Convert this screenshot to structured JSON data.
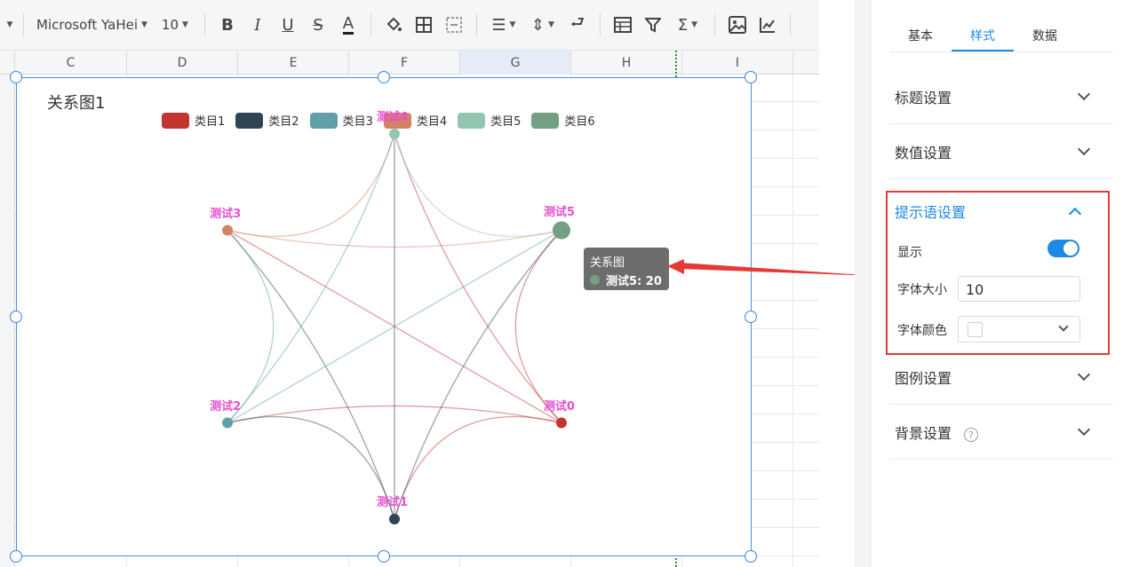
{
  "toolbar": {
    "font_name": "Microsoft YaHei",
    "font_size": "10",
    "icons": [
      "dropdown-caret",
      "bold",
      "italic",
      "underline",
      "strikethrough",
      "font-color",
      "fill-color",
      "borders",
      "merge-cells",
      "align",
      "vertical-align",
      "wrap-text",
      "table",
      "filter",
      "sum",
      "image",
      "chart"
    ]
  },
  "columns": [
    "C",
    "D",
    "E",
    "F",
    "G",
    "H",
    "I"
  ],
  "chart": {
    "title": "关系图1",
    "legend": [
      {
        "label": "类目1",
        "color": "#c23531"
      },
      {
        "label": "类目2",
        "color": "#2f4554"
      },
      {
        "label": "类目3",
        "color": "#61a0a8"
      },
      {
        "label": "类目4",
        "color": "#d48265"
      },
      {
        "label": "类目5",
        "color": "#91c7ae"
      },
      {
        "label": "类目6",
        "color": "#749f83"
      }
    ],
    "nodes": [
      {
        "name": "测试0",
        "color": "#c23531"
      },
      {
        "name": "测试1",
        "color": "#2f4554"
      },
      {
        "name": "测试2",
        "color": "#61a0a8"
      },
      {
        "name": "测试3",
        "color": "#d48265"
      },
      {
        "name": "测试4",
        "color": "#91c7ae"
      },
      {
        "name": "测试5",
        "color": "#749f83"
      }
    ],
    "node_label_color": "#e64fd0",
    "tooltip": {
      "title": "关系图",
      "value": "测试5: 20",
      "dot_color": "#749f83"
    }
  },
  "panel": {
    "tabs": [
      "基本",
      "样式",
      "数据"
    ],
    "active_tab": "样式",
    "sections": {
      "title_settings": "标题设置",
      "value_settings": "数值设置",
      "tooltip_settings": "提示语设置",
      "legend_settings": "图例设置",
      "background_settings": "背景设置"
    },
    "tooltip_fields": {
      "show_label": "显示",
      "show": true,
      "font_size_label": "字体大小",
      "font_size_value": "10",
      "font_color_label": "字体颜色"
    },
    "help_icon": "?"
  }
}
